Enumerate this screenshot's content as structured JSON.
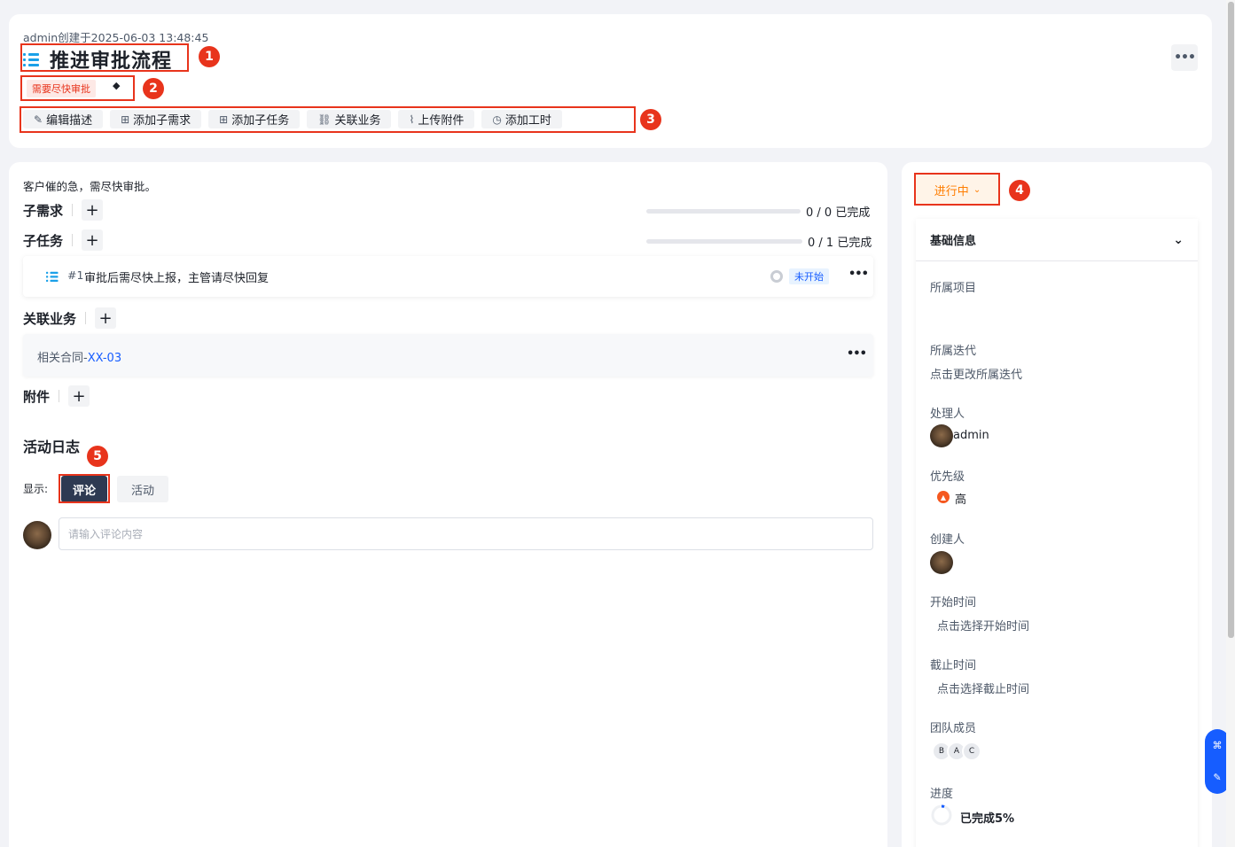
{
  "header": {
    "meta": "admin创建于2025-06-03 13:48:45",
    "title": "推进审批流程",
    "tag": "需要尽快审批",
    "toolbar": [
      {
        "icon": "✎",
        "label": "编辑描述"
      },
      {
        "icon": "⊞",
        "label": "添加子需求"
      },
      {
        "icon": "⊞",
        "label": "添加子任务"
      },
      {
        "icon": "⛓",
        "label": "关联业务"
      },
      {
        "icon": "⌇",
        "label": "上传附件"
      },
      {
        "icon": "◷",
        "label": "添加工时"
      }
    ],
    "more": "•••"
  },
  "annotations": [
    "1",
    "2",
    "3",
    "4",
    "5"
  ],
  "main": {
    "description": "客户催的急，需尽快审批。",
    "sub_requirements": {
      "title": "子需求",
      "progress": "0 / 0 已完成",
      "fraction": 0
    },
    "sub_tasks": {
      "title": "子任务",
      "progress": "0 / 1 已完成",
      "fraction": 0
    },
    "task": {
      "num": "#1",
      "text": "审批后需尽快上报，主管请尽快回复",
      "status": "未开始"
    },
    "related": {
      "title": "关联业务",
      "prefix": "相关合同-",
      "link": "XX-03"
    },
    "attachments": {
      "title": "附件"
    },
    "activity": {
      "title": "活动日志",
      "show_label": "显示:",
      "filters": [
        "评论",
        "活动"
      ],
      "active_filter": "评论",
      "comment_placeholder": "请输入评论内容"
    }
  },
  "side": {
    "status": "进行中",
    "panel_title": "基础信息",
    "fields": {
      "project": {
        "label": "所属项目",
        "value": ""
      },
      "iteration": {
        "label": "所属迭代",
        "value": "点击更改所属迭代"
      },
      "assignee": {
        "label": "处理人",
        "value": "admin"
      },
      "priority": {
        "label": "优先级",
        "value": "高"
      },
      "creator": {
        "label": "创建人"
      },
      "start": {
        "label": "开始时间",
        "value": "点击选择开始时间"
      },
      "due": {
        "label": "截止时间",
        "value": "点击选择截止时间"
      },
      "team": {
        "label": "团队成员",
        "members": [
          "B",
          "A",
          "C"
        ]
      },
      "progress": {
        "label": "进度",
        "value": "已完成5%",
        "percent": 5
      }
    }
  },
  "colors": {
    "accent": "#165dff",
    "highlight": "#e8341c",
    "status": "#ff7d00",
    "task_icon": "#1aa0e8"
  }
}
